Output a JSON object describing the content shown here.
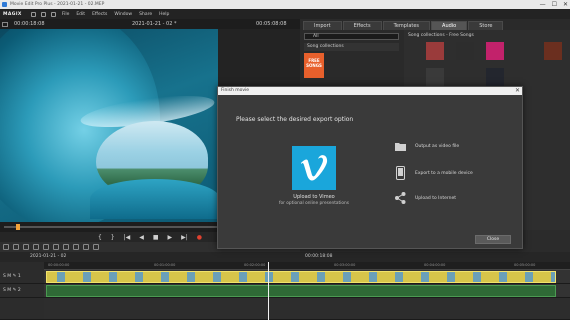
{
  "window": {
    "title": "Movie Edit Pro Plus - 2021-01-21 - 02.MEP",
    "controls": [
      "—",
      "☐",
      "✕"
    ]
  },
  "menubar": {
    "logo": "MAGIX",
    "items": [
      "File",
      "Edit",
      "Effects",
      "Window",
      "Share",
      "Help"
    ]
  },
  "preview": {
    "timecode_left": "00:00:18:08",
    "title": "2021-01-21 - 02 *",
    "timecode_right": "00:05:08:08"
  },
  "media_pool": {
    "tabs": [
      "Import",
      "Effects",
      "Templates",
      "Audio",
      "Store"
    ],
    "active_tab": "Audio",
    "filter": "All",
    "folder": "Song collections",
    "thumb_label": "FREE SONGS",
    "path": "Song collections - Free Songs"
  },
  "timeline": {
    "project": "2021-01-21 - 02",
    "timecode": "00:00:18:08",
    "ruler": [
      "00:00:00:00",
      "00:01:00:00",
      "00:02:00:00",
      "00:03:00:00",
      "00:04:00:00",
      "00:05:00:00"
    ],
    "tracks": [
      "1",
      "2"
    ]
  },
  "dialog": {
    "title": "Finish movie",
    "heading": "Please select the desired export option",
    "vimeo_label": "Upload to Vimeo",
    "vimeo_sub": "for optional online presentations",
    "options": [
      "Output as video file",
      "Export to a mobile device",
      "Upload to Internet"
    ],
    "close": "Close"
  },
  "colors": {
    "accent_vimeo": "#1aa6db",
    "playhead": "#f2a33a",
    "clip_video": "#d7c54a",
    "clip_audio": "#2f6a36",
    "record": "#e0412f"
  }
}
